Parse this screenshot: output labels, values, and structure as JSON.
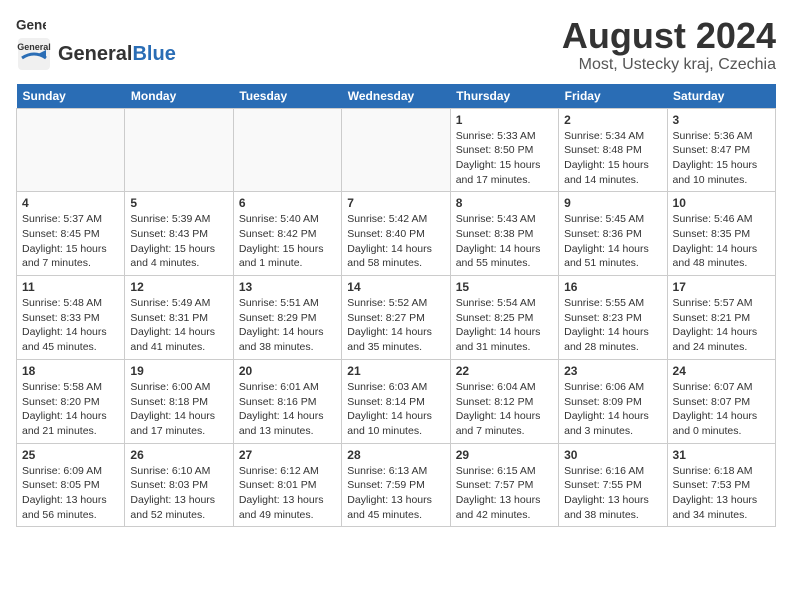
{
  "header": {
    "logo_general": "General",
    "logo_blue": "Blue",
    "month_year": "August 2024",
    "location": "Most, Ustecky kraj, Czechia"
  },
  "weekdays": [
    "Sunday",
    "Monday",
    "Tuesday",
    "Wednesday",
    "Thursday",
    "Friday",
    "Saturday"
  ],
  "weeks": [
    [
      {
        "day": "",
        "info": ""
      },
      {
        "day": "",
        "info": ""
      },
      {
        "day": "",
        "info": ""
      },
      {
        "day": "",
        "info": ""
      },
      {
        "day": "1",
        "info": "Sunrise: 5:33 AM\nSunset: 8:50 PM\nDaylight: 15 hours\nand 17 minutes."
      },
      {
        "day": "2",
        "info": "Sunrise: 5:34 AM\nSunset: 8:48 PM\nDaylight: 15 hours\nand 14 minutes."
      },
      {
        "day": "3",
        "info": "Sunrise: 5:36 AM\nSunset: 8:47 PM\nDaylight: 15 hours\nand 10 minutes."
      }
    ],
    [
      {
        "day": "4",
        "info": "Sunrise: 5:37 AM\nSunset: 8:45 PM\nDaylight: 15 hours\nand 7 minutes."
      },
      {
        "day": "5",
        "info": "Sunrise: 5:39 AM\nSunset: 8:43 PM\nDaylight: 15 hours\nand 4 minutes."
      },
      {
        "day": "6",
        "info": "Sunrise: 5:40 AM\nSunset: 8:42 PM\nDaylight: 15 hours\nand 1 minute."
      },
      {
        "day": "7",
        "info": "Sunrise: 5:42 AM\nSunset: 8:40 PM\nDaylight: 14 hours\nand 58 minutes."
      },
      {
        "day": "8",
        "info": "Sunrise: 5:43 AM\nSunset: 8:38 PM\nDaylight: 14 hours\nand 55 minutes."
      },
      {
        "day": "9",
        "info": "Sunrise: 5:45 AM\nSunset: 8:36 PM\nDaylight: 14 hours\nand 51 minutes."
      },
      {
        "day": "10",
        "info": "Sunrise: 5:46 AM\nSunset: 8:35 PM\nDaylight: 14 hours\nand 48 minutes."
      }
    ],
    [
      {
        "day": "11",
        "info": "Sunrise: 5:48 AM\nSunset: 8:33 PM\nDaylight: 14 hours\nand 45 minutes."
      },
      {
        "day": "12",
        "info": "Sunrise: 5:49 AM\nSunset: 8:31 PM\nDaylight: 14 hours\nand 41 minutes."
      },
      {
        "day": "13",
        "info": "Sunrise: 5:51 AM\nSunset: 8:29 PM\nDaylight: 14 hours\nand 38 minutes."
      },
      {
        "day": "14",
        "info": "Sunrise: 5:52 AM\nSunset: 8:27 PM\nDaylight: 14 hours\nand 35 minutes."
      },
      {
        "day": "15",
        "info": "Sunrise: 5:54 AM\nSunset: 8:25 PM\nDaylight: 14 hours\nand 31 minutes."
      },
      {
        "day": "16",
        "info": "Sunrise: 5:55 AM\nSunset: 8:23 PM\nDaylight: 14 hours\nand 28 minutes."
      },
      {
        "day": "17",
        "info": "Sunrise: 5:57 AM\nSunset: 8:21 PM\nDaylight: 14 hours\nand 24 minutes."
      }
    ],
    [
      {
        "day": "18",
        "info": "Sunrise: 5:58 AM\nSunset: 8:20 PM\nDaylight: 14 hours\nand 21 minutes."
      },
      {
        "day": "19",
        "info": "Sunrise: 6:00 AM\nSunset: 8:18 PM\nDaylight: 14 hours\nand 17 minutes."
      },
      {
        "day": "20",
        "info": "Sunrise: 6:01 AM\nSunset: 8:16 PM\nDaylight: 14 hours\nand 13 minutes."
      },
      {
        "day": "21",
        "info": "Sunrise: 6:03 AM\nSunset: 8:14 PM\nDaylight: 14 hours\nand 10 minutes."
      },
      {
        "day": "22",
        "info": "Sunrise: 6:04 AM\nSunset: 8:12 PM\nDaylight: 14 hours\nand 7 minutes."
      },
      {
        "day": "23",
        "info": "Sunrise: 6:06 AM\nSunset: 8:09 PM\nDaylight: 14 hours\nand 3 minutes."
      },
      {
        "day": "24",
        "info": "Sunrise: 6:07 AM\nSunset: 8:07 PM\nDaylight: 14 hours\nand 0 minutes."
      }
    ],
    [
      {
        "day": "25",
        "info": "Sunrise: 6:09 AM\nSunset: 8:05 PM\nDaylight: 13 hours\nand 56 minutes."
      },
      {
        "day": "26",
        "info": "Sunrise: 6:10 AM\nSunset: 8:03 PM\nDaylight: 13 hours\nand 52 minutes."
      },
      {
        "day": "27",
        "info": "Sunrise: 6:12 AM\nSunset: 8:01 PM\nDaylight: 13 hours\nand 49 minutes."
      },
      {
        "day": "28",
        "info": "Sunrise: 6:13 AM\nSunset: 7:59 PM\nDaylight: 13 hours\nand 45 minutes."
      },
      {
        "day": "29",
        "info": "Sunrise: 6:15 AM\nSunset: 7:57 PM\nDaylight: 13 hours\nand 42 minutes."
      },
      {
        "day": "30",
        "info": "Sunrise: 6:16 AM\nSunset: 7:55 PM\nDaylight: 13 hours\nand 38 minutes."
      },
      {
        "day": "31",
        "info": "Sunrise: 6:18 AM\nSunset: 7:53 PM\nDaylight: 13 hours\nand 34 minutes."
      }
    ]
  ]
}
